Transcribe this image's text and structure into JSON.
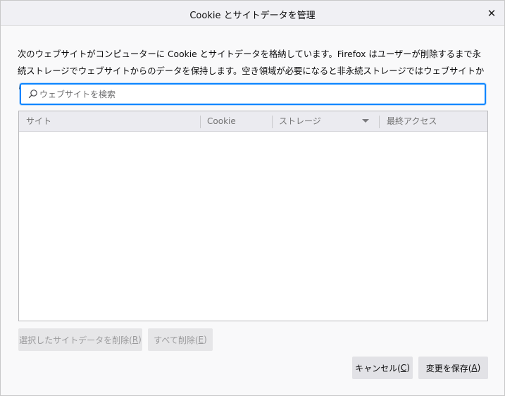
{
  "dialog": {
    "title": "Cookie とサイトデータを管理",
    "close_symbol": "✕",
    "description": "次のウェブサイトがコンピューターに Cookie とサイトデータを格納しています。Firefox はユーザーが削除するまで永続ストレージでウェブサイトからのデータを保持します。空き領域が必要になると非永続ストレージではウェブサイトからのデータが削除されます。"
  },
  "search": {
    "placeholder": "ウェブサイトを検索",
    "value": "",
    "icon": "search-icon"
  },
  "table": {
    "columns": [
      "サイト",
      "Cookie",
      "ストレージ",
      "最終アクセス"
    ],
    "sorted_column": "ストレージ",
    "rows": []
  },
  "buttons": {
    "remove_selected_label": "選択したサイトデータを削除(",
    "remove_selected_key": "R",
    "remove_selected_end": ")",
    "remove_all_label": "すべて削除(",
    "remove_all_key": "E",
    "remove_all_end": ")",
    "cancel_label": "キャンセル(",
    "cancel_key": "C",
    "cancel_end": ")",
    "save_label": "変更を保存(",
    "save_key": "A",
    "save_end": ")"
  },
  "colors": {
    "focus_ring": "#0a84ff",
    "header_bg": "#ebebf0",
    "dialog_bg": "#f9f9fa"
  }
}
